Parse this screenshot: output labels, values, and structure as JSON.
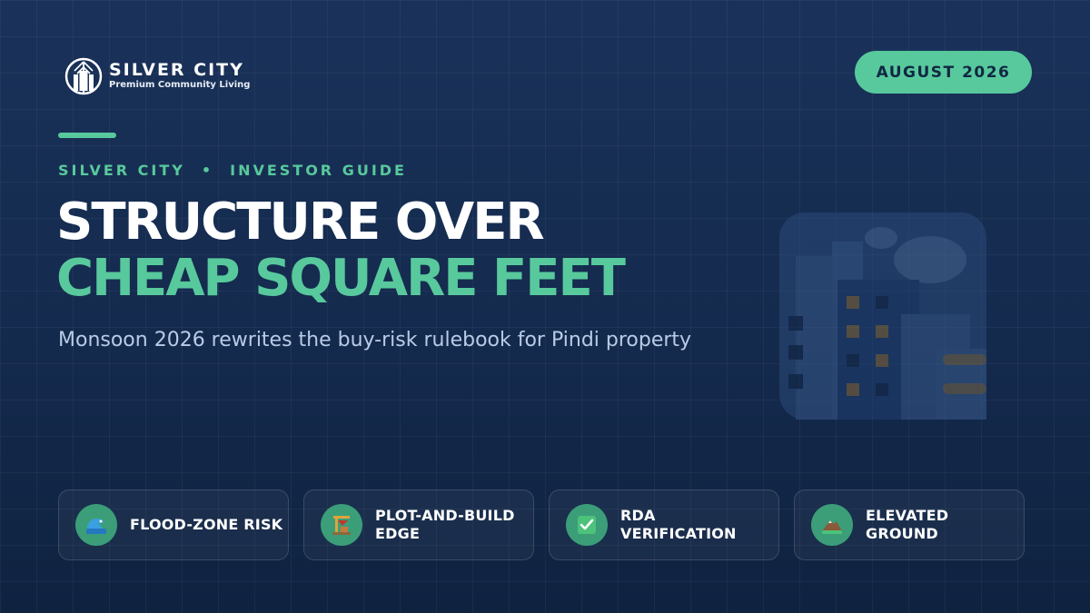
{
  "brand": {
    "name": "SILVER CITY",
    "tagline": "Premium Community Living"
  },
  "date_badge": "AUGUST 2026",
  "eyebrow": {
    "left": "SILVER CITY",
    "separator": "•",
    "right": "INVESTOR GUIDE"
  },
  "headline": {
    "line1": "STRUCTURE OVER",
    "line2": "CHEAP SQUARE FEET"
  },
  "subtitle": "Monsoon 2026 rewrites the buy-risk rulebook for Pindi property",
  "colors": {
    "accent": "#58c99c",
    "background": "#142a4d",
    "icon_circle": "#3b9e79"
  },
  "cards": [
    {
      "label": "FLOOD-ZONE RISK",
      "icon": "flood-wave-icon"
    },
    {
      "label": "PLOT-AND-BUILD EDGE",
      "icon": "construction-crane-icon"
    },
    {
      "label": "RDA VERIFICATION",
      "icon": "checkmark-icon"
    },
    {
      "label": "ELEVATED GROUND",
      "icon": "hill-icon"
    }
  ]
}
